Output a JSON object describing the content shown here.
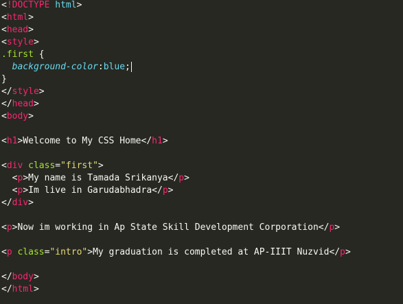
{
  "editor": {
    "lines": [
      {
        "segments": [
          {
            "c": "p",
            "v": "<"
          },
          {
            "c": "t",
            "v": "!DOCTYPE"
          },
          {
            "c": "p",
            "v": " "
          },
          {
            "c": "d",
            "v": "html"
          },
          {
            "c": "p",
            "v": ">"
          }
        ]
      },
      {
        "segments": [
          {
            "c": "p",
            "v": "<"
          },
          {
            "c": "t",
            "v": "html"
          },
          {
            "c": "p",
            "v": ">"
          }
        ]
      },
      {
        "segments": [
          {
            "c": "p",
            "v": "<"
          },
          {
            "c": "t",
            "v": "head"
          },
          {
            "c": "p",
            "v": ">"
          }
        ]
      },
      {
        "segments": [
          {
            "c": "p",
            "v": "<"
          },
          {
            "c": "t",
            "v": "style"
          },
          {
            "c": "p",
            "v": ">"
          }
        ]
      },
      {
        "segments": [
          {
            "c": "a",
            "v": ".first"
          },
          {
            "c": "p",
            "v": " "
          },
          {
            "c": "p",
            "v": "{"
          }
        ]
      },
      {
        "segments": [
          {
            "c": "p",
            "v": "  "
          },
          {
            "c": "i",
            "v": "background-color"
          },
          {
            "c": "p",
            "v": ":"
          },
          {
            "c": "d",
            "v": "blue"
          },
          {
            "c": "p",
            "v": ";"
          }
        ],
        "cursor": true
      },
      {
        "segments": [
          {
            "c": "p",
            "v": "}"
          }
        ]
      },
      {
        "segments": [
          {
            "c": "p",
            "v": "</"
          },
          {
            "c": "t",
            "v": "style"
          },
          {
            "c": "p",
            "v": ">"
          }
        ]
      },
      {
        "segments": [
          {
            "c": "p",
            "v": "</"
          },
          {
            "c": "t",
            "v": "head"
          },
          {
            "c": "p",
            "v": ">"
          }
        ]
      },
      {
        "segments": [
          {
            "c": "p",
            "v": "<"
          },
          {
            "c": "t",
            "v": "body"
          },
          {
            "c": "p",
            "v": ">"
          }
        ]
      },
      {
        "segments": []
      },
      {
        "segments": [
          {
            "c": "p",
            "v": "<"
          },
          {
            "c": "t",
            "v": "h1"
          },
          {
            "c": "p",
            "v": ">Welcome to My CSS Home</"
          },
          {
            "c": "t",
            "v": "h1"
          },
          {
            "c": "p",
            "v": ">"
          }
        ]
      },
      {
        "segments": []
      },
      {
        "segments": [
          {
            "c": "p",
            "v": "<"
          },
          {
            "c": "t",
            "v": "div"
          },
          {
            "c": "p",
            "v": " "
          },
          {
            "c": "a",
            "v": "class"
          },
          {
            "c": "p",
            "v": "="
          },
          {
            "c": "s",
            "v": "\"first\""
          },
          {
            "c": "p",
            "v": ">"
          }
        ]
      },
      {
        "segments": [
          {
            "c": "p",
            "v": "  <"
          },
          {
            "c": "t",
            "v": "p"
          },
          {
            "c": "p",
            "v": ">My name is Tamada Srikanya</"
          },
          {
            "c": "t",
            "v": "p"
          },
          {
            "c": "p",
            "v": ">"
          }
        ]
      },
      {
        "segments": [
          {
            "c": "p",
            "v": "  <"
          },
          {
            "c": "t",
            "v": "p"
          },
          {
            "c": "p",
            "v": ">Im live in Garudabhadra</"
          },
          {
            "c": "t",
            "v": "p"
          },
          {
            "c": "p",
            "v": ">"
          }
        ]
      },
      {
        "segments": [
          {
            "c": "p",
            "v": "</"
          },
          {
            "c": "t",
            "v": "div"
          },
          {
            "c": "p",
            "v": ">"
          }
        ]
      },
      {
        "segments": []
      },
      {
        "segments": [
          {
            "c": "p",
            "v": "<"
          },
          {
            "c": "t",
            "v": "p"
          },
          {
            "c": "p",
            "v": ">Now im working in Ap State Skill Development Corporation</"
          },
          {
            "c": "t",
            "v": "p"
          },
          {
            "c": "p",
            "v": ">"
          }
        ]
      },
      {
        "segments": []
      },
      {
        "segments": [
          {
            "c": "p",
            "v": "<"
          },
          {
            "c": "t",
            "v": "p"
          },
          {
            "c": "p",
            "v": " "
          },
          {
            "c": "a",
            "v": "class"
          },
          {
            "c": "p",
            "v": "="
          },
          {
            "c": "s",
            "v": "\"intro\""
          },
          {
            "c": "p",
            "v": ">My graduation is completed at AP-IIIT Nuzvid</"
          },
          {
            "c": "t",
            "v": "p"
          },
          {
            "c": "p",
            "v": ">"
          }
        ]
      },
      {
        "segments": []
      },
      {
        "segments": [
          {
            "c": "p",
            "v": "</"
          },
          {
            "c": "t",
            "v": "body"
          },
          {
            "c": "p",
            "v": ">"
          }
        ]
      },
      {
        "segments": [
          {
            "c": "p",
            "v": "</"
          },
          {
            "c": "t",
            "v": "html"
          },
          {
            "c": "p",
            "v": ">"
          }
        ]
      }
    ]
  },
  "colors": {
    "background": "#272822",
    "tag": "#f92672",
    "plain": "#f8f8f2",
    "attribute": "#a6e22e",
    "string": "#e6db74",
    "keyword": "#66d9ef"
  }
}
